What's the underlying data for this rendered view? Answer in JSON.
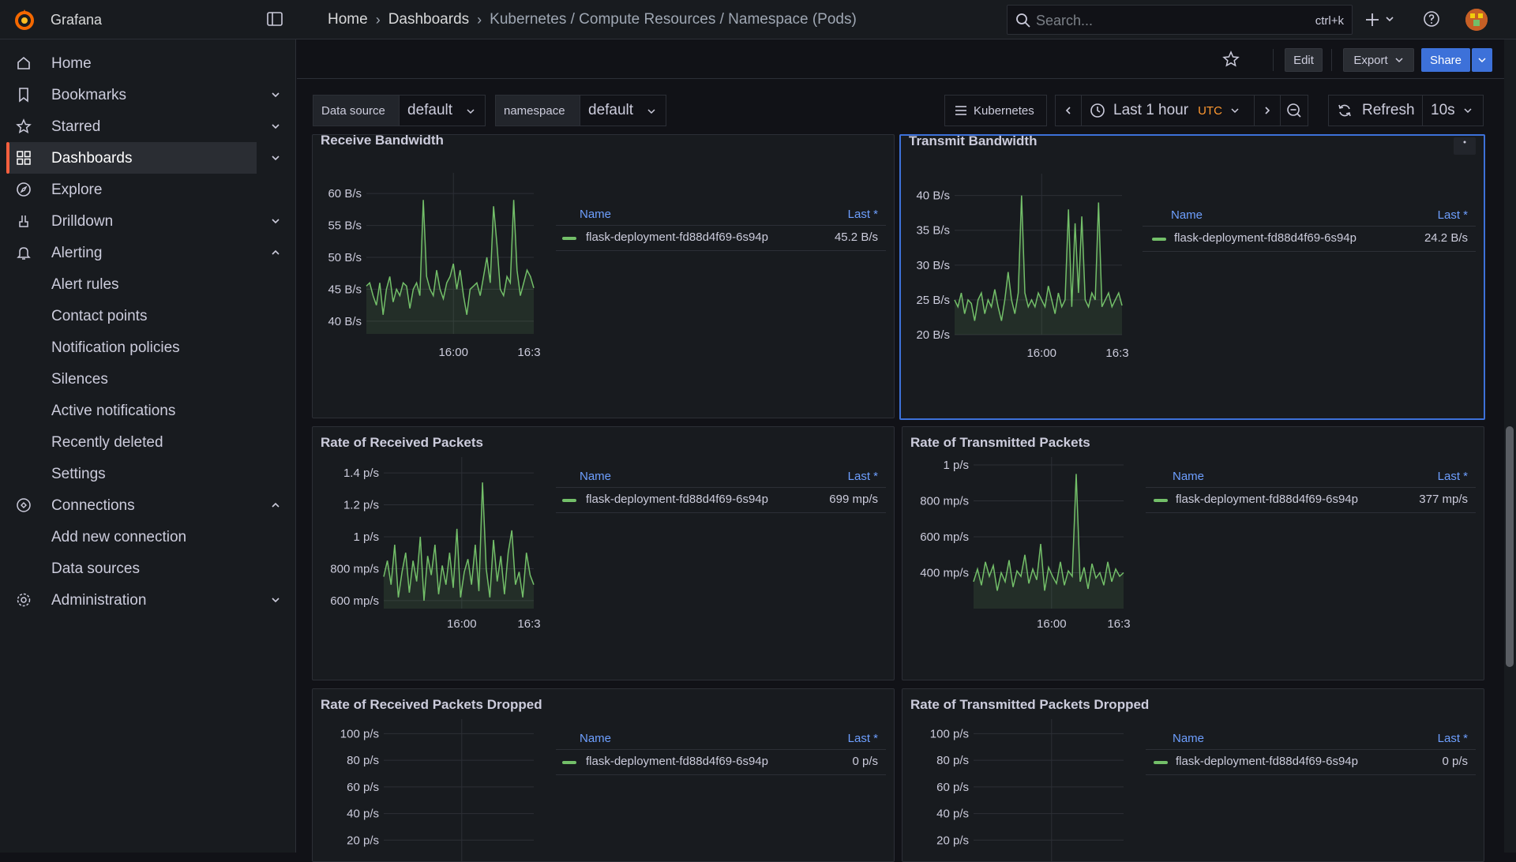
{
  "app": {
    "brand": "Grafana"
  },
  "breadcrumbs": [
    "Home",
    "Dashboards",
    "Kubernetes / Compute Resources / Namespace (Pods)"
  ],
  "breadcrumb_sep": "›",
  "search": {
    "placeholder": "Search...",
    "shortcut": "ctrl+k"
  },
  "sidebar": {
    "items": [
      {
        "label": "Home",
        "icon": "home-icon"
      },
      {
        "label": "Bookmarks",
        "icon": "bookmark-icon"
      },
      {
        "label": "Starred",
        "icon": "star-icon"
      },
      {
        "label": "Dashboards",
        "icon": "apps-icon"
      },
      {
        "label": "Explore",
        "icon": "compass-icon"
      },
      {
        "label": "Drilldown",
        "icon": "drilldown-icon"
      },
      {
        "label": "Alerting",
        "icon": "bell-icon"
      },
      {
        "label": "Alert rules"
      },
      {
        "label": "Contact points"
      },
      {
        "label": "Notification policies"
      },
      {
        "label": "Silences"
      },
      {
        "label": "Active notifications"
      },
      {
        "label": "Recently deleted"
      },
      {
        "label": "Settings"
      },
      {
        "label": "Connections",
        "icon": "connections-icon"
      },
      {
        "label": "Add new connection"
      },
      {
        "label": "Data sources"
      },
      {
        "label": "Administration",
        "icon": "cog-icon"
      }
    ]
  },
  "toolbar": {
    "edit": "Edit",
    "export": "Export",
    "share": "Share"
  },
  "variables": {
    "datasource_label": "Data source",
    "datasource_value": "default",
    "namespace_label": "namespace",
    "namespace_value": "default"
  },
  "timebar": {
    "kubernetes": "Kubernetes",
    "range": "Last 1 hour",
    "tz": "UTC",
    "refresh": "Refresh",
    "interval": "10s"
  },
  "legend": {
    "name_header": "Name",
    "last_header": "Last *"
  },
  "panels": [
    {
      "title": "Receive Bandwidth",
      "series": "flask-deployment-fd88d4f69-6s94p",
      "last": "45.2 B/s"
    },
    {
      "title": "Transmit Bandwidth",
      "series": "flask-deployment-fd88d4f69-6s94p",
      "last": "24.2 B/s"
    },
    {
      "title": "Rate of Received Packets",
      "series": "flask-deployment-fd88d4f69-6s94p",
      "last": "699 mp/s"
    },
    {
      "title": "Rate of Transmitted Packets",
      "series": "flask-deployment-fd88d4f69-6s94p",
      "last": "377 mp/s"
    },
    {
      "title": "Rate of Received Packets Dropped",
      "series": "flask-deployment-fd88d4f69-6s94p",
      "last": "0 p/s"
    },
    {
      "title": "Rate of Transmitted Packets Dropped",
      "series": "flask-deployment-fd88d4f69-6s94p",
      "last": "0 p/s"
    }
  ],
  "colors": {
    "series": "#73bf69",
    "accent": "#f55f3e",
    "primary": "#3d71d9",
    "legend_header": "#6e9fff",
    "utc": "#ff9830"
  },
  "chart_data": [
    {
      "type": "line",
      "title": "Receive Bandwidth",
      "ylim": [
        38,
        62
      ],
      "yticks": [
        "60 B/s",
        "55 B/s",
        "50 B/s",
        "45 B/s",
        "40 B/s"
      ],
      "ytick_values": [
        60,
        55,
        50,
        45,
        40
      ],
      "xticks": [
        "16:00",
        "16:3"
      ],
      "series": [
        {
          "values": [
            45.5,
            46,
            44,
            42.5,
            46,
            41,
            45,
            47,
            43,
            45,
            44,
            46,
            45.5,
            42,
            45,
            46,
            44,
            59,
            47,
            45,
            44,
            48,
            45,
            43.5,
            46,
            47,
            49,
            45,
            48,
            44,
            41,
            45,
            45.5,
            46,
            44,
            47,
            50,
            46,
            58,
            52,
            45,
            44,
            47,
            46,
            59,
            48,
            44,
            46,
            48,
            47,
            45.2
          ]
        }
      ]
    },
    {
      "type": "line",
      "title": "Transmit Bandwidth",
      "ylim": [
        20,
        42
      ],
      "yticks": [
        "40 B/s",
        "35 B/s",
        "30 B/s",
        "25 B/s",
        "20 B/s"
      ],
      "ytick_values": [
        40,
        35,
        30,
        25,
        20
      ],
      "xticks": [
        "16:00",
        "16:3"
      ],
      "series": [
        {
          "values": [
            25,
            24,
            26,
            23,
            25,
            24.5,
            22,
            25,
            26,
            23,
            25,
            24,
            26.5,
            24,
            22,
            25,
            29,
            25,
            23,
            26,
            40,
            26,
            24,
            25,
            24,
            26,
            25,
            24,
            27,
            25,
            23,
            26,
            24,
            25,
            38,
            24,
            36,
            26,
            37,
            25,
            24,
            26,
            25,
            39,
            24,
            25,
            26,
            24,
            25,
            26,
            24.2
          ]
        }
      ]
    },
    {
      "type": "line",
      "title": "Rate of Received Packets",
      "ylim": [
        550,
        1450
      ],
      "yticks": [
        "1.4 p/s",
        "1.2 p/s",
        "1 p/s",
        "800 mp/s",
        "600 mp/s"
      ],
      "ytick_values": [
        1400,
        1200,
        1000,
        800,
        600
      ],
      "xticks": [
        "16:00",
        "16:3"
      ],
      "series": [
        {
          "values": [
            750,
            850,
            700,
            950,
            620,
            780,
            900,
            650,
            850,
            720,
            1000,
            600,
            880,
            760,
            950,
            640,
            820,
            700,
            900,
            680,
            1050,
            620,
            780,
            860,
            700,
            950,
            660,
            1340,
            800,
            620,
            980,
            720,
            880,
            640,
            900,
            1040,
            700,
            780,
            620,
            900,
            760,
            700
          ]
        }
      ]
    },
    {
      "type": "line",
      "title": "Rate of Transmitted Packets",
      "ylim": [
        200,
        1000
      ],
      "yticks": [
        "1 p/s",
        "800 mp/s",
        "600 mp/s",
        "400 mp/s"
      ],
      "ytick_values": [
        1000,
        800,
        600,
        400
      ],
      "xticks": [
        "16:00",
        "16:3"
      ],
      "series": [
        {
          "values": [
            350,
            420,
            330,
            460,
            380,
            440,
            300,
            400,
            350,
            470,
            320,
            410,
            380,
            500,
            340,
            420,
            360,
            560,
            300,
            430,
            380,
            340,
            460,
            330,
            410,
            380,
            950,
            350,
            430,
            310,
            450,
            370,
            400,
            330,
            460,
            350,
            420,
            380,
            400
          ]
        }
      ]
    },
    {
      "type": "line",
      "title": "Rate of Received Packets Dropped",
      "ylim": [
        0,
        105
      ],
      "yticks": [
        "100 p/s",
        "80 p/s",
        "60 p/s",
        "40 p/s",
        "20 p/s"
      ],
      "ytick_values": [
        100,
        80,
        60,
        40,
        20
      ],
      "xticks": [],
      "series": [
        {
          "values": [
            0,
            0
          ]
        }
      ]
    },
    {
      "type": "line",
      "title": "Rate of Transmitted Packets Dropped",
      "ylim": [
        0,
        105
      ],
      "yticks": [
        "100 p/s",
        "80 p/s",
        "60 p/s",
        "40 p/s",
        "20 p/s"
      ],
      "ytick_values": [
        100,
        80,
        60,
        40,
        20
      ],
      "xticks": [],
      "series": [
        {
          "values": [
            0,
            0
          ]
        }
      ]
    }
  ]
}
